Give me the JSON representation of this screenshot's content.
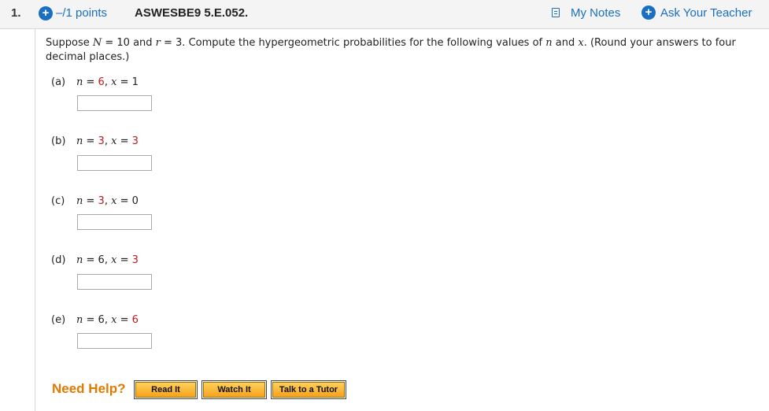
{
  "header": {
    "question_number": "1.",
    "points": "–/1 points",
    "assignment_code": "ASWESBE9 5.E.052.",
    "my_notes_label": "My Notes",
    "ask_teacher_label": "Ask Your Teacher"
  },
  "prompt": {
    "p1": "Suppose ",
    "N": "N",
    "p2": " = 10 and ",
    "r": "r",
    "p3": " = 3. Compute the hypergeometric probabilities for the following values of ",
    "n": "n",
    "p4": " and ",
    "x": "x",
    "p5": ". (Round your answers to four decimal places.)"
  },
  "parts": [
    {
      "letter": "(a)",
      "n": "6",
      "x": "1",
      "n_red": true,
      "x_red": false
    },
    {
      "letter": "(b)",
      "n": "3",
      "x": "3",
      "n_red": true,
      "x_red": true
    },
    {
      "letter": "(c)",
      "n": "3",
      "x": "0",
      "n_red": true,
      "x_red": false
    },
    {
      "letter": "(d)",
      "n": "6",
      "x": "3",
      "n_red": false,
      "x_red": true
    },
    {
      "letter": "(e)",
      "n": "6",
      "x": "6",
      "n_red": false,
      "x_red": true
    }
  ],
  "help": {
    "label": "Need Help?",
    "read_it": "Read It",
    "watch_it": "Watch It",
    "talk_to_tutor": "Talk to a Tutor"
  },
  "colors": {
    "link_blue": "#1a6fc2",
    "highlight_red": "#c0181e",
    "help_orange": "#e17a00"
  }
}
